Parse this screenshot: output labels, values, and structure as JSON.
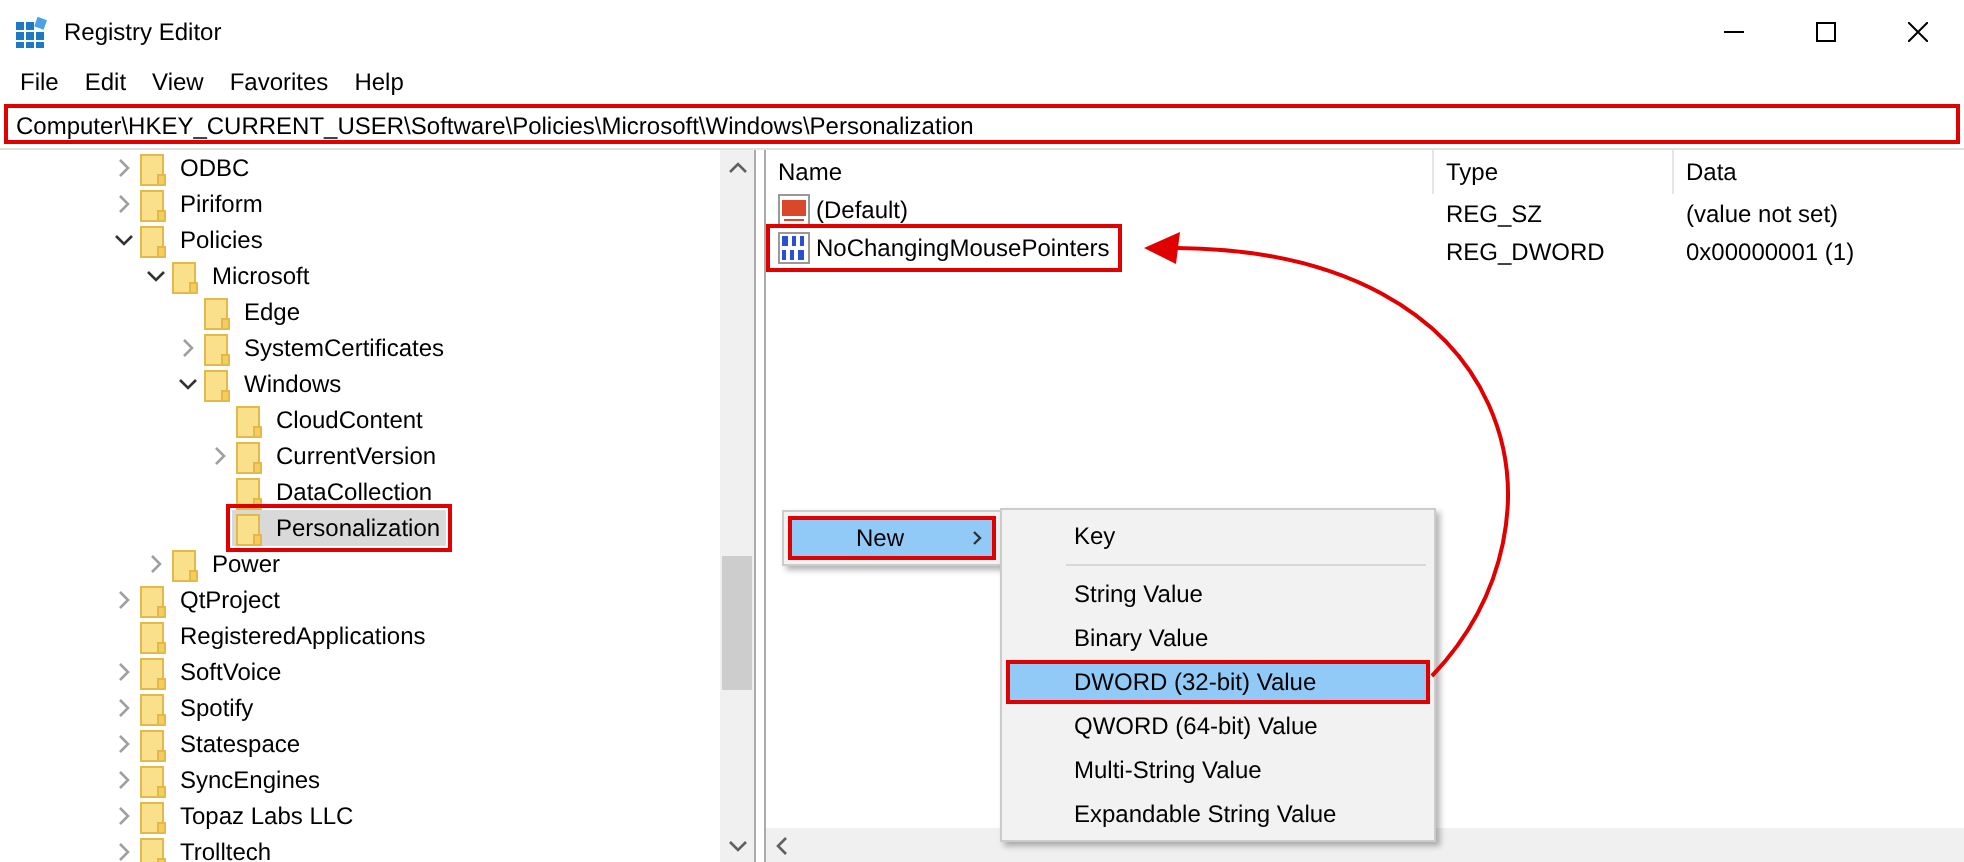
{
  "window": {
    "title": "Registry Editor"
  },
  "menu": [
    "File",
    "Edit",
    "View",
    "Favorites",
    "Help"
  ],
  "address_bar": {
    "value": "Computer\\HKEY_CURRENT_USER\\Software\\Policies\\Microsoft\\Windows\\Personalization",
    "highlighted": true
  },
  "tree": [
    {
      "label": "ODBC",
      "expanded": false,
      "selected": false,
      "highlighted": false
    },
    {
      "label": "Piriform",
      "expanded": false,
      "selected": false,
      "highlighted": false
    },
    {
      "label": "Policies",
      "expanded": true,
      "selected": false,
      "highlighted": false,
      "children": [
        {
          "label": "Microsoft",
          "expanded": true,
          "selected": false,
          "highlighted": false,
          "children": [
            {
              "label": "Edge",
              "selected": false,
              "highlighted": false
            },
            {
              "label": "SystemCertificates",
              "expanded": false,
              "selected": false,
              "highlighted": false
            },
            {
              "label": "Windows",
              "expanded": true,
              "selected": false,
              "highlighted": false,
              "children": [
                {
                  "label": "CloudContent",
                  "selected": false,
                  "highlighted": false
                },
                {
                  "label": "CurrentVersion",
                  "expanded": false,
                  "selected": false,
                  "highlighted": false
                },
                {
                  "label": "DataCollection",
                  "selected": false,
                  "highlighted": false
                },
                {
                  "label": "Personalization",
                  "selected": true,
                  "highlighted": true
                }
              ]
            }
          ]
        },
        {
          "label": "Power",
          "expanded": false,
          "selected": false,
          "highlighted": false
        }
      ]
    },
    {
      "label": "QtProject",
      "expanded": false,
      "selected": false,
      "highlighted": false
    },
    {
      "label": "RegisteredApplications",
      "selected": false,
      "highlighted": false
    },
    {
      "label": "SoftVoice",
      "expanded": false,
      "selected": false,
      "highlighted": false
    },
    {
      "label": "Spotify",
      "expanded": false,
      "selected": false,
      "highlighted": false
    },
    {
      "label": "Statespace",
      "expanded": false,
      "selected": false,
      "highlighted": false
    },
    {
      "label": "SyncEngines",
      "expanded": false,
      "selected": false,
      "highlighted": false
    },
    {
      "label": "Topaz Labs LLC",
      "expanded": false,
      "selected": false,
      "highlighted": false
    },
    {
      "label": "Trolltech",
      "expanded": false,
      "selected": false,
      "highlighted": false
    }
  ],
  "values_table": {
    "columns": [
      "Name",
      "Type",
      "Data"
    ],
    "rows": [
      {
        "kind": "string",
        "name": "(Default)",
        "type": "REG_SZ",
        "data": "(value not set)",
        "highlighted": false
      },
      {
        "kind": "dword",
        "name": "NoChangingMousePointers",
        "type": "REG_DWORD",
        "data": "0x00000001 (1)",
        "highlighted": true
      }
    ]
  },
  "context_menu": {
    "items": [
      {
        "label": "New",
        "selected": true,
        "highlighted": true
      }
    ]
  },
  "submenu": {
    "items": [
      {
        "kind": "item",
        "label": "Key",
        "selected": false,
        "highlighted": false
      },
      {
        "kind": "separator"
      },
      {
        "kind": "item",
        "label": "String Value",
        "selected": false,
        "highlighted": false
      },
      {
        "kind": "item",
        "label": "Binary Value",
        "selected": false,
        "highlighted": false
      },
      {
        "kind": "item",
        "label": "DWORD (32-bit) Value",
        "selected": true,
        "highlighted": true
      },
      {
        "kind": "item",
        "label": "QWORD (64-bit) Value",
        "selected": false,
        "highlighted": false
      },
      {
        "kind": "item",
        "label": "Multi-String Value",
        "selected": false,
        "highlighted": false
      },
      {
        "kind": "item",
        "label": "Expandable String Value",
        "selected": false,
        "highlighted": false
      }
    ]
  }
}
